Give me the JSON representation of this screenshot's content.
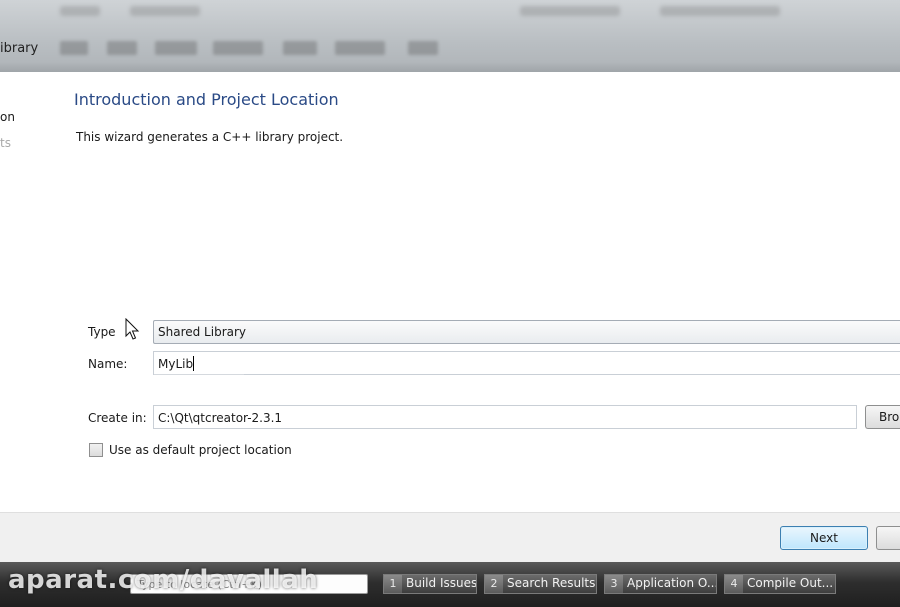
{
  "window": {
    "title_fragment": "ibrary"
  },
  "sidebar": {
    "steps": [
      {
        "label": "on",
        "state": "active"
      },
      {
        "label": "ts",
        "state": "inactive"
      }
    ]
  },
  "page": {
    "title": "Introduction and Project Location",
    "description": "This wizard generates a C++ library project.",
    "type_label": "Type",
    "type_value": "Shared Library",
    "name_label": "Name:",
    "name_value": "MyLib",
    "create_in_label": "Create in:",
    "create_in_value": "C:\\Qt\\qtcreator-2.3.1",
    "browse_label": "Bro",
    "default_location_label": "Use as default project location",
    "default_location_checked": false
  },
  "buttons": {
    "next_label": "Next"
  },
  "statusbar": {
    "locator_placeholder": "Type to locate (Ctrl+K)",
    "tabs": [
      {
        "number": "1",
        "label": "Build Issues"
      },
      {
        "number": "2",
        "label": "Search Results"
      },
      {
        "number": "3",
        "label": "Application O..."
      },
      {
        "number": "4",
        "label": "Compile Out..."
      }
    ]
  },
  "watermark": {
    "text": "aparat.com/davallah"
  },
  "colors": {
    "title_blue": "#2a4a86",
    "next_button_border": "#3c7fb1",
    "statusbar_dark": "#2e2e2e"
  }
}
